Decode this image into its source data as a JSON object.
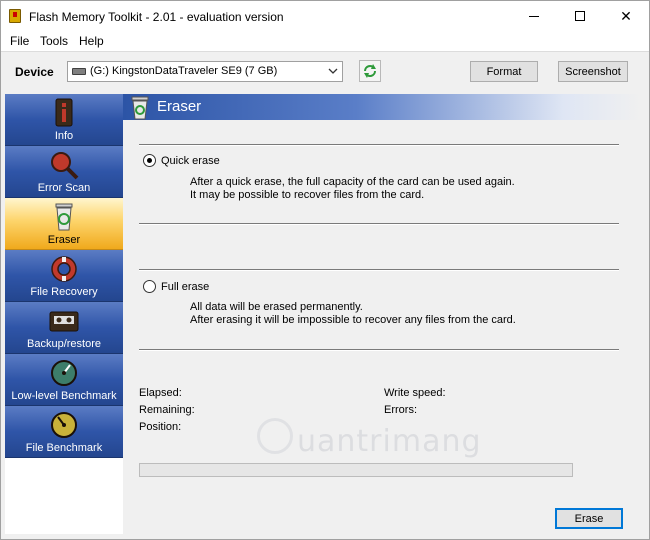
{
  "window": {
    "title": "Flash Memory Toolkit - 2.01 - evaluation version",
    "minimize_glyph": "—",
    "maximize_glyph": "☐",
    "close_glyph": "✕"
  },
  "menu": {
    "items": [
      "File",
      "Tools",
      "Help"
    ]
  },
  "toolbar": {
    "device_label": "Device",
    "device_value": "(G:) KingstonDataTraveler SE9 (7 GB)",
    "format_label": "Format",
    "screenshot_label": "Screenshot"
  },
  "sidebar": {
    "items": [
      {
        "label": "Info",
        "icon": "info-icon"
      },
      {
        "label": "Error Scan",
        "icon": "magnifier-icon"
      },
      {
        "label": "Eraser",
        "icon": "recycle-bin-icon",
        "active": true
      },
      {
        "label": "File Recovery",
        "icon": "lifebuoy-icon"
      },
      {
        "label": "Backup/restore",
        "icon": "cassette-icon"
      },
      {
        "label": "Low-level Benchmark",
        "icon": "gauge-icon"
      },
      {
        "label": "File Benchmark",
        "icon": "gauge-icon"
      }
    ]
  },
  "eraser": {
    "title": "Eraser",
    "quick_label": "Quick erase",
    "quick_desc_1": "After a quick erase, the full capacity of the card can be used again.",
    "quick_desc_2": "It may be possible to recover files from the card.",
    "full_label": "Full erase",
    "full_desc_1": "All data will be erased permanently.",
    "full_desc_2": "After erasing it will be impossible to recover any files from the card.",
    "selected": "quick",
    "elapsed_label": "Elapsed:",
    "remaining_label": "Remaining:",
    "position_label": "Position:",
    "write_speed_label": "Write speed:",
    "errors_label": "Errors:",
    "progress": 0,
    "erase_label": "Erase"
  },
  "watermark": {
    "text": "uantrimang"
  },
  "colors": {
    "nav_blue": "#2f55a8",
    "nav_active": "#fdd46a",
    "accent": "#0078d7"
  }
}
